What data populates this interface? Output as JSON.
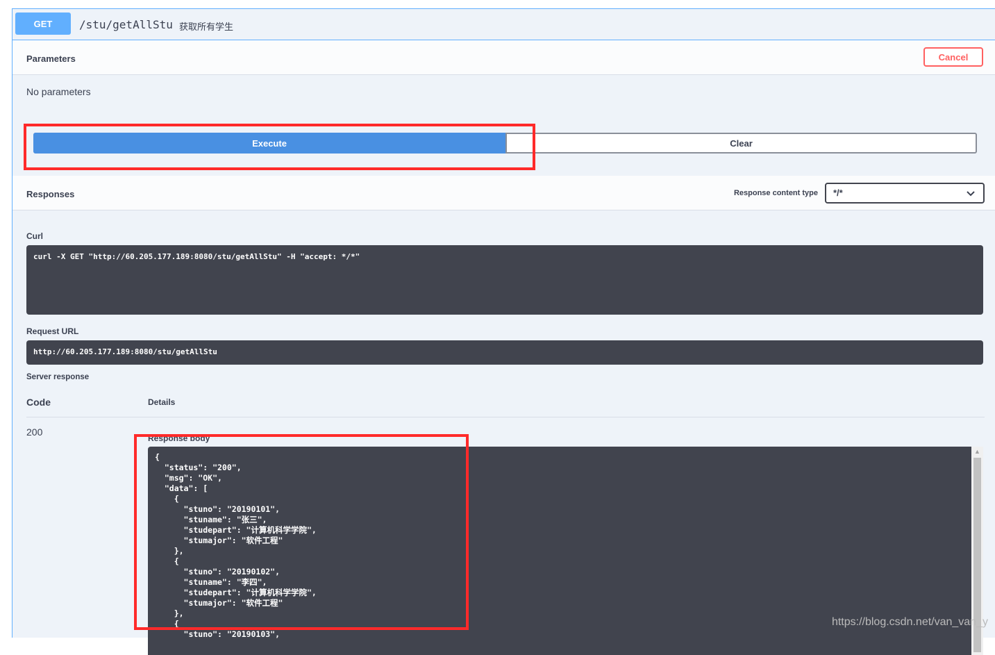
{
  "endpoint": {
    "method": "GET",
    "path": "/stu/getAllStu",
    "description": "获取所有学生"
  },
  "parameters": {
    "title": "Parameters",
    "cancel_label": "Cancel",
    "empty_text": "No parameters"
  },
  "actions": {
    "execute_label": "Execute",
    "clear_label": "Clear"
  },
  "responses": {
    "title": "Responses",
    "content_type_label": "Response content type",
    "content_type_value": "*/*"
  },
  "curl": {
    "label": "Curl",
    "command": "curl -X GET \"http://60.205.177.189:8080/stu/getAllStu\" -H \"accept: */*\""
  },
  "request_url": {
    "label": "Request URL",
    "value": "http://60.205.177.189:8080/stu/getAllStu"
  },
  "server_response": {
    "label": "Server response",
    "code_header": "Code",
    "details_header": "Details",
    "status_code": "200",
    "response_body_label": "Response body",
    "body_lines": [
      "{",
      "  \"status\": \"200\",",
      "  \"msg\": \"OK\",",
      "  \"data\": [",
      "    {",
      "      \"stuno\": \"20190101\",",
      "      \"stuname\": \"张三\",",
      "      \"studepart\": \"计算机科学学院\",",
      "      \"stumajor\": \"软件工程\"",
      "    },",
      "    {",
      "      \"stuno\": \"20190102\",",
      "      \"stuname\": \"李四\",",
      "      \"studepart\": \"计算机科学学院\",",
      "      \"stumajor\": \"软件工程\"",
      "    },",
      "    {",
      "      \"stuno\": \"20190103\","
    ]
  },
  "watermark": "https://blog.csdn.net/van_van_y",
  "colors": {
    "get_blue": "#61affe",
    "execute_blue": "#4990e2",
    "cancel_red": "#ff6060",
    "highlight_red": "#ff2a2a",
    "code_bg": "#41444e"
  }
}
